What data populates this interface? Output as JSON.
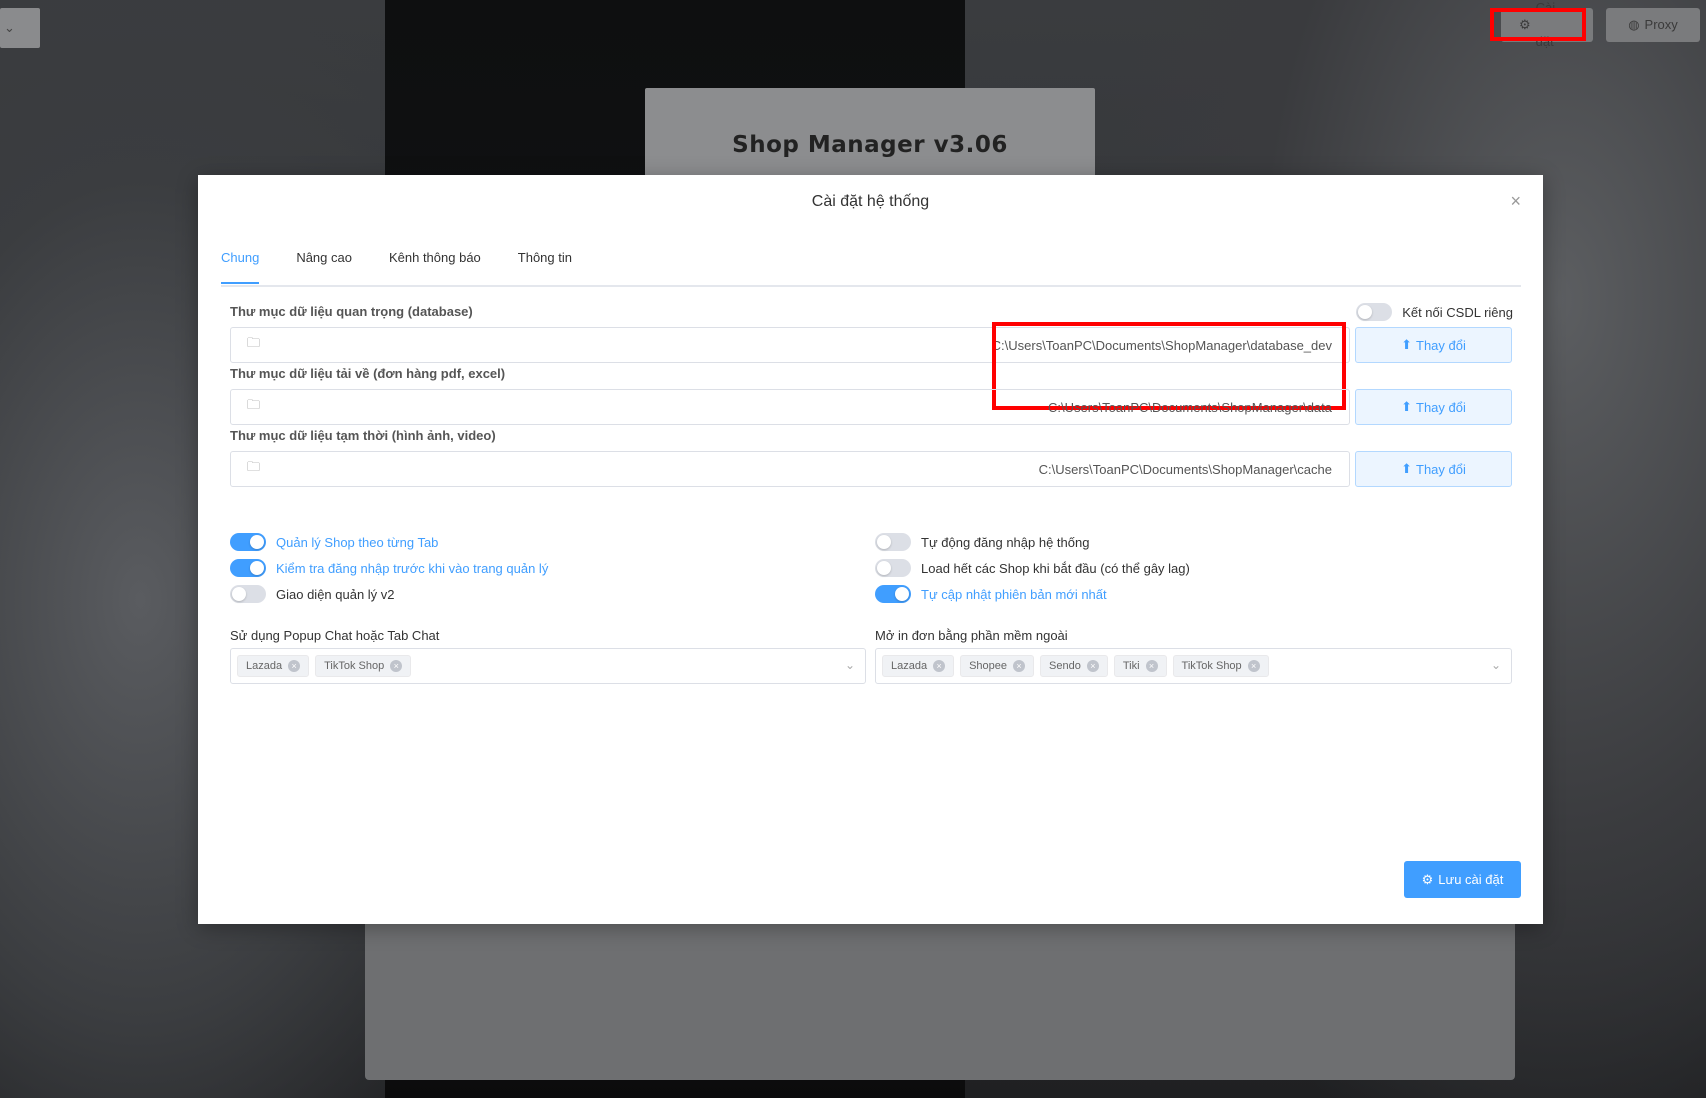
{
  "app": {
    "title": "Shop Manager v3.06"
  },
  "topbar": {
    "settings_label": "Cài đặt",
    "proxy_label": "Proxy"
  },
  "modal": {
    "title": "Cài đặt hệ thống",
    "tabs": [
      {
        "label": "Chung",
        "active": true
      },
      {
        "label": "Nâng cao",
        "active": false
      },
      {
        "label": "Kênh thông báo",
        "active": false
      },
      {
        "label": "Thông tin",
        "active": false
      }
    ],
    "private_db": {
      "label": "Kết nối CSDL riêng",
      "on": false
    },
    "folders": [
      {
        "label": "Thư mục dữ liệu quan trọng (database)",
        "path": "C:\\Users\\ToanPC\\Documents\\ShopManager\\database_dev",
        "button": "Thay đổi"
      },
      {
        "label": "Thư mục dữ liệu tải về (đơn hàng pdf, excel)",
        "path": "C:\\Users\\ToanPC\\Documents\\ShopManager\\data",
        "button": "Thay đổi"
      },
      {
        "label": "Thư mục dữ liệu tạm thời (hình ảnh, video)",
        "path": "C:\\Users\\ToanPC\\Documents\\ShopManager\\cache",
        "button": "Thay đổi"
      }
    ],
    "switches_left": [
      {
        "label": "Quản lý Shop theo từng Tab",
        "on": true
      },
      {
        "label": "Kiểm tra đăng nhập trước khi vào trang quản lý",
        "on": true
      },
      {
        "label": "Giao diện quản lý v2",
        "on": false
      }
    ],
    "switches_right": [
      {
        "label": "Tự động đăng nhập hệ thống",
        "on": false
      },
      {
        "label": "Load hết các Shop khi bắt đầu (có thể gây lag)",
        "on": false
      },
      {
        "label": "Tự cập nhật phiên bản mới nhất",
        "on": true
      }
    ],
    "chat_select": {
      "label": "Sử dụng Popup Chat hoặc Tab Chat",
      "tags": [
        "Lazada",
        "TikTok Shop"
      ]
    },
    "print_select": {
      "label": "Mở in đơn bằng phần mềm ngoài",
      "tags": [
        "Lazada",
        "Shopee",
        "Sendo",
        "Tiki",
        "TikTok Shop"
      ]
    },
    "save_label": "Lưu cài đặt"
  },
  "colors": {
    "primary": "#409eff",
    "highlight": "#ff0000"
  }
}
